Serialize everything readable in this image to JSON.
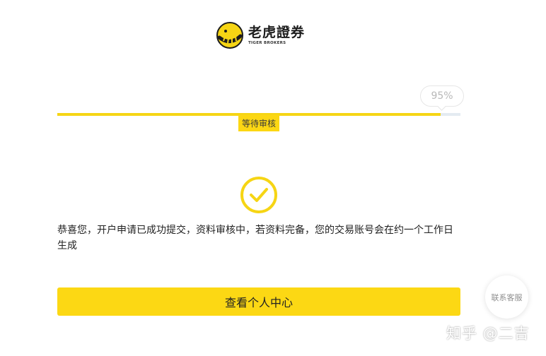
{
  "brand": {
    "name": "老虎證券",
    "subtitle": "TIGER BROKERS",
    "logo_icon": "tiger-logo-icon",
    "color": "#f6d514"
  },
  "progress": {
    "percent_label": "95%",
    "value": 0.95,
    "stage_label": "等待审核",
    "fill_color": "#f6d514",
    "track_color": "#e4ebf1"
  },
  "status": {
    "icon": "check-circle-icon",
    "message": "恭喜您，开户申请已成功提交，资料审核中，若资料完备，您的交易账号会在约一个工作日生成"
  },
  "actions": {
    "view_center_label": "查看个人中心",
    "customer_service_label": "联系客服"
  },
  "watermark": {
    "text": "知乎 @二吉"
  }
}
